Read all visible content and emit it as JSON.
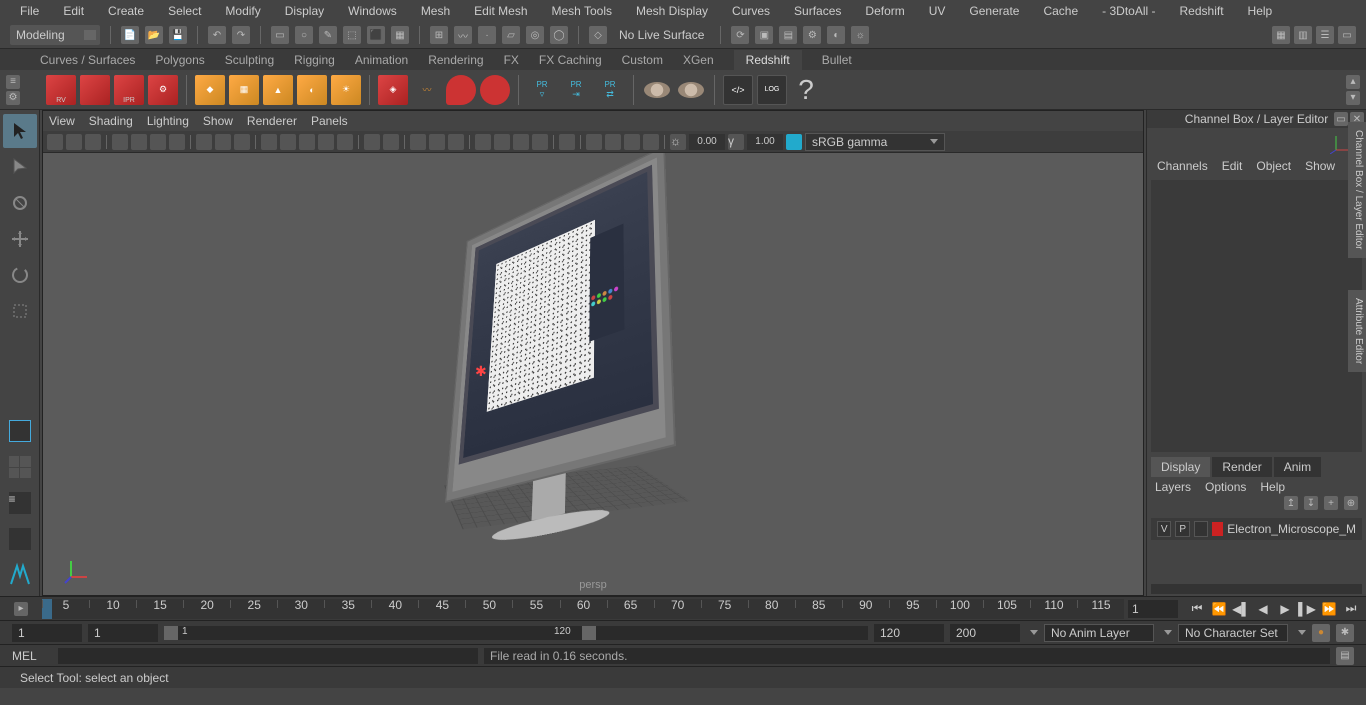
{
  "menubar": [
    "File",
    "Edit",
    "Create",
    "Select",
    "Modify",
    "Display",
    "Windows",
    "Mesh",
    "Edit Mesh",
    "Mesh Tools",
    "Mesh Display",
    "Curves",
    "Surfaces",
    "Deform",
    "UV",
    "Generate",
    "Cache",
    "- 3DtoAll -",
    "Redshift",
    "Help"
  ],
  "workspace": {
    "label": "Modeling",
    "nolive": "No Live Surface"
  },
  "shelf_tabs": [
    "Curves / Surfaces",
    "Polygons",
    "Sculpting",
    "Rigging",
    "Animation",
    "Rendering",
    "FX",
    "FX Caching",
    "Custom",
    "XGen",
    "Redshift",
    "Bullet"
  ],
  "shelf_active": "Redshift",
  "shelf_redboxes": [
    "RV",
    "",
    "IPR",
    ""
  ],
  "shelf_pr": [
    "PR",
    "PR",
    "PR"
  ],
  "viewport_menu": [
    "View",
    "Shading",
    "Lighting",
    "Show",
    "Renderer",
    "Panels"
  ],
  "viewport": {
    "exposure": "0.00",
    "gamma": "1.00",
    "colorspace": "sRGB gamma",
    "camera": "persp"
  },
  "channel_box": {
    "title": "Channel Box / Layer Editor",
    "tabs": [
      "Channels",
      "Edit",
      "Object",
      "Show"
    ],
    "display_tabs": [
      "Display",
      "Render",
      "Anim"
    ],
    "display_active": "Display",
    "layer_tabs": [
      "Layers",
      "Options",
      "Help"
    ],
    "layer": {
      "v": "V",
      "p": "P",
      "color": "#c22",
      "name": "Electron_Microscope_M"
    }
  },
  "side_tabs": [
    "Channel Box / Layer Editor",
    "Attribute Editor"
  ],
  "timeline": {
    "ticks": [
      5,
      10,
      15,
      20,
      25,
      30,
      35,
      40,
      45,
      50,
      55,
      60,
      65,
      70,
      75,
      80,
      85,
      90,
      95,
      100,
      105,
      110,
      115
    ],
    "current": "1",
    "end_field": "1"
  },
  "range": {
    "start": "1",
    "inner_start": "1",
    "inner_end": "120",
    "end": "120",
    "end2": "200",
    "anim_layer": "No Anim Layer",
    "char_set": "No Character Set"
  },
  "cmd": {
    "label": "MEL",
    "output": "File read in  0.16 seconds."
  },
  "status": "Select Tool: select an object"
}
